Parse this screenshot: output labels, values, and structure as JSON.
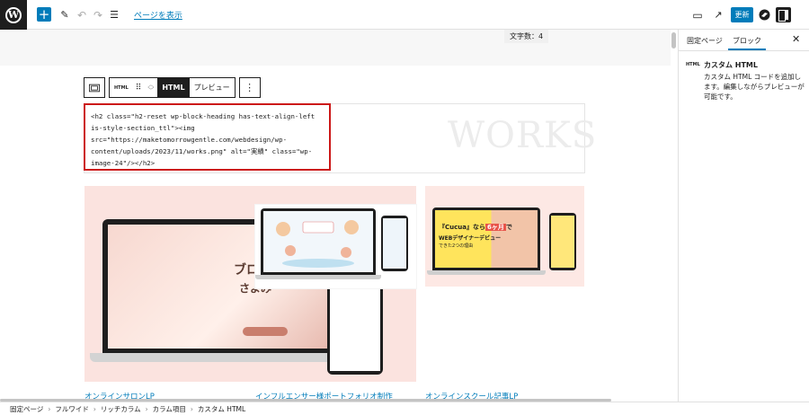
{
  "topbar": {
    "logo": "W",
    "add_icon": "+",
    "tool_icon": "✎",
    "undo_icon": "↶",
    "redo_icon": "↷",
    "list_view_icon": "☰",
    "view_page_label": "ページを表示",
    "preview_icon": "▭",
    "external_icon": "↗",
    "update_label": "更新",
    "settings_icon": "▣"
  },
  "canvas": {
    "word_count": "文字数：4",
    "block_toolbar": {
      "html_icon_label": "HTML",
      "drag_icon": "⠿",
      "html_tab": "HTML",
      "preview_tab": "プレビュー",
      "more_icon": "⋮"
    },
    "html_code": "<h2 class=\"h2-reset wp-block-heading has-text-align-left is-style-section_ttl\"><img src=\"https://maketomorrowgentle.com/webdesign/wp-content/uploads/2023/11/works.png\" alt=\"実績\" class=\"wp-image-24\"/></h2>",
    "works_heading": "WORKS",
    "thumb1_title": "ブログの",
    "thumb1_subtitle": "さよみ",
    "thumb3_tag_prefix": "『Cucua』なら",
    "thumb3_tag_highlight": "6ヶ月",
    "thumb3_tag_suffix": "で",
    "thumb3_line2": "WEBデザイナーデビュー",
    "thumb3_line3": "できた2つの理由",
    "captions": [
      "オンラインサロンLP",
      "インフルエンサー様ポートフォリオ制作",
      "オンラインスクール記事LP"
    ]
  },
  "sidebar": {
    "tab_page": "固定ページ",
    "tab_block": "ブロック",
    "close_icon": "✕",
    "block_icon": "HTML",
    "block_title": "カスタム HTML",
    "block_description": "カスタム HTML コードを追加します。編集しながらプレビューが可能です。"
  },
  "breadcrumb": [
    "固定ページ",
    "フルワイド",
    "リッチカラム",
    "カラム項目",
    "カスタム HTML"
  ],
  "colors": {
    "accent": "#007cba",
    "selected_border": "#cc1818",
    "dark": "#1e1e1e"
  }
}
